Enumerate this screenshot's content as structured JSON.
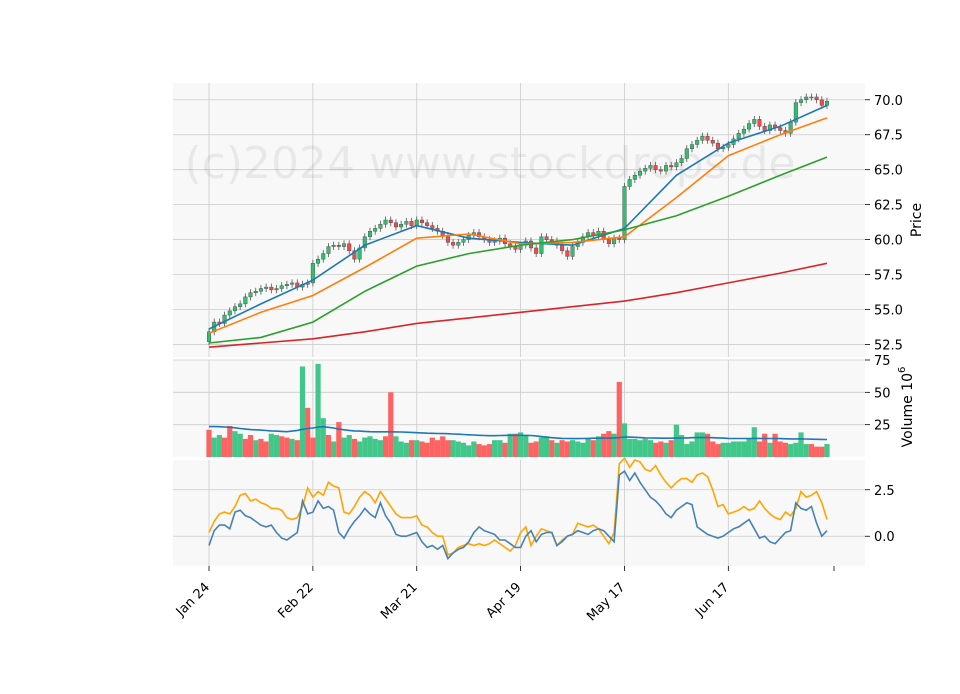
{
  "watermark": "(c)2024 www.stockdrops.de",
  "chart_data": {
    "type": "candlestick",
    "x_tick_labels": [
      "Jan 24",
      "Feb 22",
      "Mar 21",
      "Apr 19",
      "May 17",
      "Jun 17"
    ],
    "x_tick_index": [
      0,
      20,
      40,
      60,
      80,
      100
    ],
    "num_bars": 120,
    "price_panel": {
      "ylabel": "Price",
      "ylim": [
        51.6,
        71.2
      ],
      "ticks": [
        52.5,
        55.0,
        57.5,
        60.0,
        62.5,
        65.0,
        67.5,
        70.0
      ],
      "tick_labels": [
        "52.5",
        "55.0",
        "57.5",
        "60.0",
        "62.5",
        "65.0",
        "67.5",
        "70.0"
      ],
      "close": [
        53.4,
        54.1,
        54.0,
        54.6,
        54.9,
        55.2,
        55.4,
        55.9,
        56.2,
        56.3,
        56.5,
        56.6,
        56.4,
        56.5,
        56.7,
        56.8,
        56.9,
        56.6,
        56.8,
        56.9,
        58.3,
        58.6,
        59.0,
        59.5,
        59.6,
        59.5,
        59.7,
        59.2,
        58.6,
        59.4,
        60.2,
        60.6,
        60.8,
        61.1,
        61.4,
        61.2,
        60.9,
        61.1,
        61.3,
        61.0,
        61.4,
        61.2,
        61.0,
        60.8,
        60.6,
        60.3,
        59.8,
        59.6,
        59.8,
        60.0,
        60.3,
        60.5,
        60.2,
        60.0,
        59.8,
        59.9,
        60.1,
        59.7,
        59.5,
        59.3,
        59.6,
        59.9,
        59.4,
        59.0,
        60.2,
        60.0,
        59.9,
        59.6,
        59.2,
        58.8,
        59.5,
        59.8,
        60.2,
        60.5,
        60.3,
        60.6,
        60.0,
        59.7,
        60.1,
        60.0,
        63.8,
        64.3,
        64.6,
        64.9,
        65.1,
        65.3,
        65.0,
        64.9,
        65.3,
        65.2,
        65.5,
        65.8,
        66.5,
        66.8,
        67.1,
        67.4,
        67.1,
        66.9,
        66.5,
        66.6,
        66.8,
        67.2,
        67.6,
        67.9,
        68.3,
        68.6,
        68.1,
        67.8,
        68.2,
        68.0,
        67.8,
        67.6,
        68.4,
        69.8,
        70.0,
        70.2,
        70.2,
        70.0,
        69.6,
        69.9
      ],
      "moving_averages": [
        {
          "color": "#1f77b4",
          "start": 53.6,
          "points": [
            [
              0,
              53.6
            ],
            [
              10,
              55.4
            ],
            [
              20,
              57.1
            ],
            [
              30,
              59.6
            ],
            [
              40,
              61.0
            ],
            [
              50,
              60.1
            ],
            [
              60,
              59.8
            ],
            [
              70,
              59.6
            ],
            [
              80,
              60.8
            ],
            [
              90,
              64.6
            ],
            [
              100,
              66.9
            ],
            [
              110,
              68.1
            ],
            [
              119,
              69.6
            ]
          ]
        },
        {
          "color": "#ff7f0e",
          "start": 53.3,
          "points": [
            [
              0,
              53.3
            ],
            [
              10,
              54.8
            ],
            [
              20,
              56.0
            ],
            [
              30,
              58.0
            ],
            [
              40,
              60.1
            ],
            [
              50,
              60.4
            ],
            [
              60,
              59.7
            ],
            [
              70,
              59.8
            ],
            [
              80,
              60.2
            ],
            [
              90,
              63.0
            ],
            [
              100,
              66.0
            ],
            [
              110,
              67.5
            ],
            [
              119,
              68.7
            ]
          ]
        },
        {
          "color": "#2ca02c",
          "start": 52.6,
          "points": [
            [
              0,
              52.6
            ],
            [
              10,
              53.0
            ],
            [
              20,
              54.1
            ],
            [
              30,
              56.3
            ],
            [
              40,
              58.1
            ],
            [
              50,
              59.0
            ],
            [
              60,
              59.6
            ],
            [
              70,
              60.0
            ],
            [
              80,
              60.7
            ],
            [
              90,
              61.7
            ],
            [
              100,
              63.1
            ],
            [
              110,
              64.6
            ],
            [
              119,
              65.9
            ]
          ]
        },
        {
          "color": "#d62728",
          "start": 52.3,
          "points": [
            [
              0,
              52.3
            ],
            [
              10,
              52.6
            ],
            [
              20,
              52.9
            ],
            [
              30,
              53.4
            ],
            [
              40,
              54.0
            ],
            [
              50,
              54.4
            ],
            [
              60,
              54.8
            ],
            [
              70,
              55.2
            ],
            [
              80,
              55.6
            ],
            [
              90,
              56.2
            ],
            [
              100,
              56.9
            ],
            [
              110,
              57.6
            ],
            [
              119,
              58.3
            ]
          ]
        }
      ]
    },
    "volume_panel": {
      "ylabel": "Volume",
      "ylabel_exponent": "6",
      "ylim": [
        0,
        75
      ],
      "ticks": [
        25,
        50,
        75
      ],
      "tick_labels": [
        "25",
        "50",
        "75"
      ],
      "values": [
        21,
        15,
        17,
        15,
        24,
        20,
        18,
        14,
        17,
        13,
        14,
        12,
        18,
        17,
        16,
        15,
        14,
        13,
        70,
        38,
        15,
        72,
        30,
        17,
        12,
        27,
        15,
        17,
        14,
        12,
        15,
        16,
        14,
        13,
        16,
        50,
        16,
        12,
        11,
        13,
        13,
        12,
        11,
        15,
        13,
        16,
        13,
        13,
        12,
        11,
        9,
        12,
        10,
        9,
        10,
        13,
        13,
        11,
        18,
        18,
        19,
        17,
        11,
        12,
        15,
        16,
        13,
        11,
        13,
        12,
        13,
        12,
        11,
        14,
        13,
        16,
        18,
        20,
        18,
        58,
        26,
        14,
        14,
        13,
        14,
        13,
        11,
        12,
        11,
        13,
        25,
        17,
        10,
        12,
        19,
        19,
        18,
        12,
        10,
        11,
        11,
        12,
        12,
        12,
        14,
        23,
        12,
        18,
        11,
        18,
        12,
        11,
        10,
        11,
        19,
        10,
        10,
        8,
        8,
        10
      ],
      "avg": [
        23.5,
        23.5,
        23.4,
        23.2,
        23.0,
        22.6,
        22.0,
        21.6,
        21.2,
        21.0,
        20.8,
        20.5,
        20.2,
        20.0,
        19.8,
        19.6,
        20.0,
        20.6,
        21.4,
        22.0,
        22.4,
        23.2,
        23.4,
        23.0,
        22.4,
        21.6,
        21.0,
        20.6,
        20.2,
        20.0,
        19.8,
        19.6,
        19.5,
        19.5,
        19.5,
        19.5,
        19.4,
        19.3,
        19.2,
        19.0,
        18.8,
        18.6,
        18.4,
        18.3,
        18.2,
        18.1,
        18.0,
        17.8,
        17.6,
        17.4,
        17.2,
        17.0,
        16.8,
        16.6,
        16.5,
        16.5,
        16.6,
        16.7,
        16.8,
        16.8,
        16.8,
        16.7,
        16.6,
        16.3,
        15.8,
        15.3,
        14.9,
        14.6,
        14.4,
        14.3,
        14.2,
        14.2,
        14.3,
        14.4,
        14.5,
        14.5,
        14.6,
        14.6,
        14.8,
        15.0,
        15.4,
        15.4,
        15.2,
        15.0,
        14.8,
        14.7,
        14.6,
        14.5,
        14.5,
        14.5,
        14.6,
        14.7,
        14.8,
        14.9,
        15.0,
        15.1,
        15.0,
        14.9,
        14.8,
        14.6,
        14.4,
        14.3,
        14.3,
        14.3,
        14.3,
        14.4,
        14.4,
        14.4,
        14.3,
        14.3,
        14.2,
        14.1,
        14.0,
        14.0,
        14.0,
        13.9,
        13.8,
        13.7,
        13.6,
        13.5
      ],
      "ups": [
        0,
        1,
        1,
        0,
        0,
        1,
        1,
        0,
        0,
        1,
        0,
        0,
        1,
        1,
        0,
        0,
        1,
        0,
        1,
        0,
        0,
        1,
        1,
        0,
        1,
        0,
        1,
        1,
        0,
        1,
        1,
        1,
        1,
        1,
        0,
        0,
        1,
        1,
        1,
        0,
        1,
        0,
        0,
        0,
        0,
        0,
        0,
        1,
        1,
        1,
        1,
        1,
        0,
        0,
        0,
        1,
        1,
        0,
        1,
        0,
        1,
        1,
        0,
        0,
        1,
        1,
        0,
        1,
        0,
        0,
        1,
        1,
        1,
        1,
        0,
        1,
        0,
        0,
        1,
        0,
        1,
        1,
        1,
        1,
        1,
        1,
        0,
        0,
        1,
        0,
        1,
        1,
        1,
        1,
        1,
        1,
        0,
        0,
        0,
        1,
        1,
        1,
        1,
        1,
        1,
        1,
        0,
        0,
        1,
        0,
        0,
        0,
        1,
        1,
        1,
        1,
        0,
        0,
        0,
        1
      ]
    },
    "indicator_panel": {
      "ylim": [
        -1.6,
        4.1
      ],
      "ticks": [
        0.0,
        2.5
      ],
      "tick_labels": [
        "0.0",
        "2.5"
      ],
      "series": [
        {
          "color": "#ffa500",
          "values": [
            0.2,
            0.8,
            1.2,
            1.3,
            1.2,
            1.6,
            2.2,
            2.3,
            1.9,
            2.0,
            1.8,
            1.7,
            1.5,
            1.5,
            1.4,
            1.0,
            0.9,
            1.0,
            1.6,
            2.6,
            2.1,
            2.4,
            2.2,
            2.9,
            2.7,
            2.6,
            1.3,
            1.2,
            1.6,
            2.1,
            2.4,
            2.2,
            1.8,
            2.4,
            2.0,
            1.6,
            1.2,
            1.0,
            1.0,
            1.0,
            1.1,
            0.6,
            0.5,
            0.2,
            0.0,
            0.0,
            -1.0,
            -0.9,
            -0.6,
            -0.5,
            -0.4,
            -0.5,
            -0.4,
            -0.5,
            -0.4,
            -0.2,
            -0.4,
            -0.6,
            -0.8,
            -0.5,
            0.2,
            0.5,
            -0.5,
            0.0,
            0.4,
            0.3,
            0.2,
            -0.5,
            -0.2,
            0.0,
            0.1,
            0.7,
            0.6,
            0.5,
            0.6,
            0.4,
            0.0,
            -0.4,
            0.2,
            3.9,
            4.2,
            3.7,
            4.1,
            4.0,
            3.6,
            3.5,
            3.8,
            3.3,
            2.9,
            2.6,
            2.9,
            3.1,
            3.1,
            2.9,
            3.3,
            3.4,
            3.2,
            2.5,
            1.6,
            1.7,
            1.2,
            1.3,
            1.4,
            1.6,
            1.4,
            1.5,
            1.9,
            1.5,
            1.2,
            1.0,
            0.9,
            1.3,
            1.1,
            1.5,
            2.4,
            2.1,
            2.2,
            2.4,
            1.8,
            0.9
          ]
        },
        {
          "color": "#4682b4",
          "values": [
            -0.5,
            0.3,
            0.6,
            0.6,
            0.4,
            1.3,
            1.4,
            1.1,
            1.0,
            0.8,
            0.6,
            0.5,
            0.6,
            0.2,
            -0.1,
            -0.2,
            0.0,
            0.2,
            1.9,
            1.2,
            1.3,
            1.9,
            1.5,
            1.6,
            1.4,
            0.2,
            -0.1,
            0.4,
            0.8,
            1.1,
            1.5,
            1.2,
            1.0,
            1.8,
            1.1,
            0.7,
            0.1,
            0.0,
            0.0,
            0.1,
            0.2,
            -0.3,
            -0.6,
            -0.5,
            -0.7,
            -0.5,
            -1.2,
            -0.9,
            -0.7,
            -0.6,
            -0.3,
            0.2,
            0.5,
            0.3,
            0.2,
            0.1,
            -0.2,
            -0.2,
            -0.4,
            -0.6,
            -0.6,
            0.0,
            0.3,
            -0.3,
            0.1,
            0.2,
            0.2,
            -0.5,
            -0.3,
            0.0,
            0.1,
            0.3,
            0.2,
            0.1,
            0.3,
            0.4,
            0.3,
            0.0,
            -0.3,
            3.3,
            3.5,
            3.0,
            3.4,
            2.9,
            2.5,
            2.1,
            1.9,
            1.6,
            1.2,
            1.0,
            1.4,
            1.6,
            1.8,
            1.7,
            0.5,
            0.3,
            0.1,
            0.0,
            -0.1,
            0.0,
            0.2,
            0.4,
            0.5,
            0.7,
            0.9,
            0.4,
            -0.1,
            0.0,
            -0.3,
            -0.4,
            -0.1,
            0.2,
            0.3,
            1.8,
            1.5,
            1.4,
            1.6,
            0.7,
            0.0,
            0.3
          ]
        }
      ]
    }
  }
}
